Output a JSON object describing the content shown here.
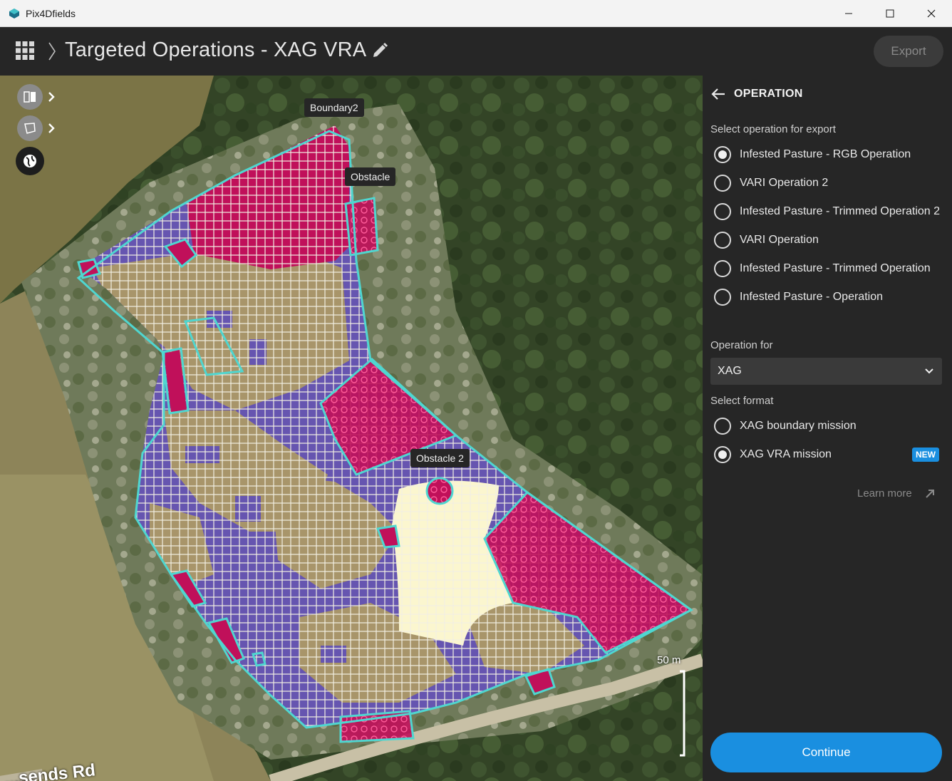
{
  "window": {
    "app_title": "Pix4Dfields"
  },
  "header": {
    "title": "Targeted Operations - XAG VRA",
    "export_label": "Export"
  },
  "map": {
    "labels": {
      "boundary": "Boundary2",
      "obstacle": "Obstacle",
      "obstacle2": "Obstacle 2"
    },
    "scale_label": "50 m",
    "road_label": "...sends Rd",
    "colors": {
      "boundary": "#4fd6d0",
      "high": "#c0105a",
      "mid": "#6655b0",
      "low": "#a8956a",
      "none": "#fbf6cf"
    }
  },
  "panel": {
    "title": "OPERATION",
    "select_operation_label": "Select operation for export",
    "operations": [
      {
        "label": "Infested Pasture - RGB Operation",
        "selected": true
      },
      {
        "label": "VARI Operation 2",
        "selected": false
      },
      {
        "label": "Infested Pasture - Trimmed Operation 2",
        "selected": false
      },
      {
        "label": "VARI Operation",
        "selected": false
      },
      {
        "label": "Infested Pasture - Trimmed Operation",
        "selected": false
      },
      {
        "label": "Infested Pasture - Operation",
        "selected": false
      }
    ],
    "operation_for_label": "Operation for",
    "operation_for_value": "XAG",
    "select_format_label": "Select format",
    "formats": [
      {
        "label": "XAG boundary mission",
        "selected": false
      },
      {
        "label": "XAG VRA mission",
        "selected": true
      }
    ],
    "new_badge": "NEW",
    "learn_more": "Learn more",
    "continue_label": "Continue"
  }
}
